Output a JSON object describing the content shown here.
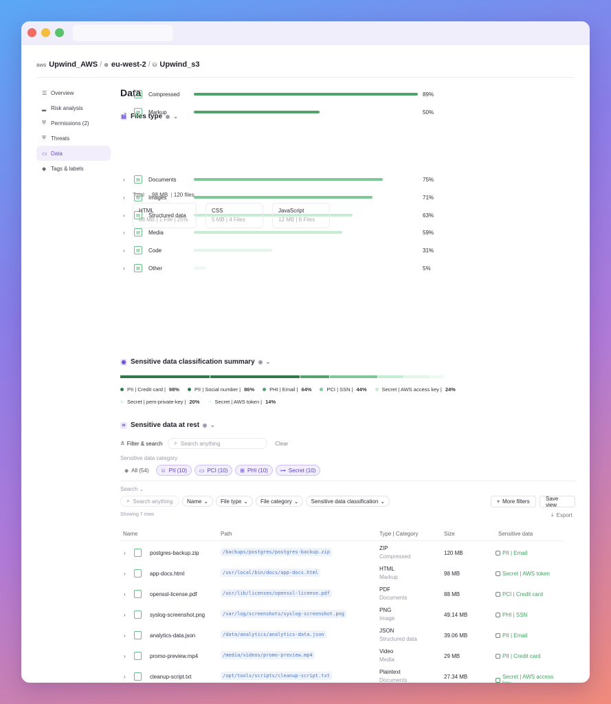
{
  "breadcrumb": {
    "account": "Upwind_AWS",
    "account_icon": "aws",
    "region": "eu-west-2",
    "bucket": "Upwind_s3",
    "sep": "/"
  },
  "sidebar": {
    "items": [
      {
        "label": "Overview",
        "icon": "list-icon"
      },
      {
        "label": "Risk analysis",
        "icon": "bars-icon"
      },
      {
        "label": "Permissions (2)",
        "icon": "shield-icon"
      },
      {
        "label": "Threats",
        "icon": "shield-alert-icon"
      },
      {
        "label": "Data",
        "icon": "database-icon",
        "active": true
      },
      {
        "label": "Tags & labels",
        "icon": "tag-icon"
      }
    ]
  },
  "page": {
    "title": "Data"
  },
  "files_type": {
    "title": "Files type",
    "rows": [
      {
        "label": "Compressed",
        "pct": "89%",
        "value": 89,
        "color": "#4fa36b",
        "expanded": false
      },
      {
        "label": "Markup",
        "pct": "50%",
        "value": 50,
        "color": "#4fa36b",
        "expanded": true
      },
      {
        "label": "Documents",
        "pct": "75%",
        "value": 75,
        "color": "#7ec796"
      },
      {
        "label": "Images",
        "pct": "71%",
        "value": 71,
        "color": "#7ec796"
      },
      {
        "label": "Structured data",
        "pct": "63%",
        "value": 63,
        "color": "#c6ecd3"
      },
      {
        "label": "Media",
        "pct": "59%",
        "value": 59,
        "color": "#c6ecd3"
      },
      {
        "label": "Code",
        "pct": "31%",
        "value": 31,
        "color": "#e3f5ea"
      },
      {
        "label": "Other",
        "pct": "5%",
        "value": 5,
        "color": "#eef9f2"
      }
    ],
    "detail": {
      "total_label": "Total",
      "total_value": "98 MB",
      "files": "120 files",
      "cards": [
        {
          "title": "HTML",
          "sub": "88 MB | 1 File | 25%"
        },
        {
          "title": "CSS",
          "sub": "5 MB | 4 Files"
        },
        {
          "title": "JavaScript",
          "sub": "12 MB | 6 Files"
        }
      ]
    }
  },
  "sensitive_summary": {
    "title": "Sensitive data classification summary",
    "segments": [
      {
        "label": "PII | Credit card",
        "value": "98%",
        "color": "#2f7a48",
        "share": 28
      },
      {
        "label": "PII | Social number",
        "value": "86%",
        "color": "#2f7a48",
        "share": 28
      },
      {
        "label": "PHI | Email",
        "value": "64%",
        "color": "#4fa36b",
        "share": 9
      },
      {
        "label": "PCI | SSN",
        "value": "44%",
        "color": "#7ec796",
        "share": 15
      },
      {
        "label": "Secret | AWS access key",
        "value": "24%",
        "color": "#c6ecd3",
        "share": 8
      },
      {
        "label": "Secret | pem-private-key",
        "value": "20%",
        "color": "#e3f5ea",
        "share": 8
      },
      {
        "label": "Secret | AWS token",
        "value": "14%",
        "color": "#eef9f2",
        "share": 4
      }
    ]
  },
  "at_rest": {
    "title": "Sensitive data at rest",
    "filter_label": "Filter & search",
    "search_placeholder": "Search anything",
    "clear_label": "Clear",
    "category_label": "Sensitive data category",
    "chips": [
      {
        "label": "All (54)",
        "selected": false
      },
      {
        "label": "PII (10)",
        "selected": true
      },
      {
        "label": "PCI (10)",
        "selected": true
      },
      {
        "label": "PHI (10)",
        "selected": true
      },
      {
        "label": "Secret (10)",
        "selected": true
      }
    ],
    "search_label": "Search",
    "search2_placeholder": "Search anything",
    "filters": [
      "Name",
      "File type",
      "File category",
      "Sensitive  data classification"
    ],
    "more_filters": "More filters",
    "save_view": "Save view",
    "showing": "Showing 7 rows",
    "export": "Export",
    "columns": [
      "Name",
      "Path",
      "Type | Category",
      "Size",
      "Sensitive data"
    ],
    "rows": [
      {
        "name": "postgres-backup.zip",
        "path": "/backups/postgres/postgres-backup.zip",
        "type": "ZIP",
        "category": "Compressed",
        "size": "120 MB",
        "sensitive": "PII | Email"
      },
      {
        "name": "app-docs.html",
        "path": "/usr/local/bin/docs/app-docs.html",
        "type": "HTML",
        "category": "Markup",
        "size": "98 MB",
        "sensitive": "Secret | AWS token"
      },
      {
        "name": "openssl-license.pdf",
        "path": "/usr/lib/licenses/openssl-license.pdf",
        "type": "PDF",
        "category": "Documents",
        "size": "88 MB",
        "sensitive": "PCI | Credit card"
      },
      {
        "name": "syslog-screenshot.png",
        "path": "/var/log/screenshots/syslog-screenshot.png",
        "type": "PNG",
        "category": "Image",
        "size": "49.14 MB",
        "sensitive": "PHI | SSN"
      },
      {
        "name": "analytics-data.json",
        "path": "/data/analytics/analytics-data.json",
        "type": "JSON",
        "category": "Structured data",
        "size": "39.06 MB",
        "sensitive": "PII | Email"
      },
      {
        "name": "promo-preview.mp4",
        "path": "/media/videos/promo-preview.mp4",
        "type": "Video",
        "category": "Media",
        "size": "29 MB",
        "sensitive": "PII | Credit card"
      },
      {
        "name": "cleanup-script.txt",
        "path": "/opt/tools/scripts/cleanup-script.txt",
        "type": "Plaintext",
        "category": "Documents",
        "size": "27.34 MB",
        "sensitive": "Secret | AWS access key"
      }
    ]
  }
}
